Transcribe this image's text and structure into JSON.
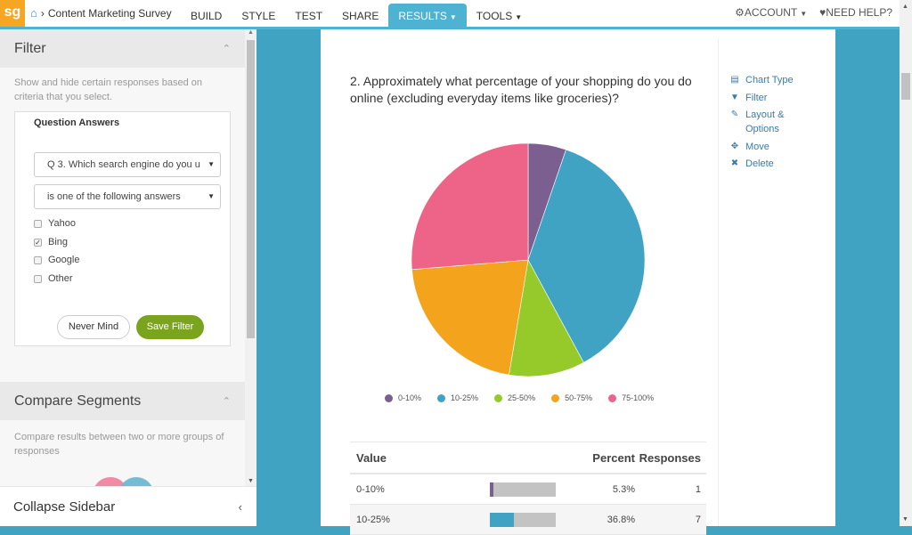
{
  "topbar": {
    "logo": "sg",
    "breadcrumb": "Content Marketing Survey",
    "tabs": [
      {
        "label": "BUILD",
        "active": false,
        "dropdown": false
      },
      {
        "label": "STYLE",
        "active": false,
        "dropdown": false
      },
      {
        "label": "TEST",
        "active": false,
        "dropdown": false
      },
      {
        "label": "SHARE",
        "active": false,
        "dropdown": false
      },
      {
        "label": "RESULTS",
        "active": true,
        "dropdown": true
      },
      {
        "label": "TOOLS",
        "active": false,
        "dropdown": true
      }
    ],
    "account_label": "ACCOUNT",
    "help_label": "NEED HELP?"
  },
  "sidebar": {
    "filter": {
      "title": "Filter",
      "description": "Show and hide certain responses based on criteria that you select.",
      "box_title": "Question Answers",
      "question_select": "Q 3. Which search engine do you u",
      "operator_select": "is one of the following answers",
      "options": [
        {
          "label": "Yahoo",
          "checked": false
        },
        {
          "label": "Bing",
          "checked": true
        },
        {
          "label": "Google",
          "checked": false
        },
        {
          "label": "Other",
          "checked": false
        }
      ],
      "cancel_label": "Never Mind",
      "save_label": "Save Filter"
    },
    "compare": {
      "title": "Compare Segments",
      "description": "Compare results between two or more groups of responses"
    },
    "collapse_label": "Collapse Sidebar"
  },
  "report": {
    "question": "2. Approximately what percentage of your shopping do you do online (excluding everyday items like groceries)?",
    "actions": [
      {
        "label": "Chart Type",
        "icon": "bar-chart-icon"
      },
      {
        "label": "Filter",
        "icon": "funnel-icon"
      },
      {
        "label": "Layout & Options",
        "icon": "pencil-icon"
      },
      {
        "label": "Move",
        "icon": "move-arrows-icon"
      },
      {
        "label": "Delete",
        "icon": "x-icon"
      }
    ],
    "table": {
      "headers": [
        "Value",
        "Percent",
        "Responses"
      ],
      "rows": [
        {
          "value": "0-10%",
          "percent": "5.3%",
          "responses": "1"
        },
        {
          "value": "10-25%",
          "percent": "36.8%",
          "responses": "7"
        }
      ]
    }
  },
  "chart_data": {
    "type": "pie",
    "title": "",
    "categories": [
      "0-10%",
      "10-25%",
      "25-50%",
      "50-75%",
      "75-100%"
    ],
    "values": [
      1,
      7,
      2,
      4,
      5
    ],
    "percent": [
      5.3,
      36.8,
      10.5,
      21.1,
      26.3
    ],
    "colors": [
      "#7b5f91",
      "#40a3c4",
      "#96c92a",
      "#f4a31c",
      "#ee6388"
    ],
    "legend": "bottom"
  }
}
